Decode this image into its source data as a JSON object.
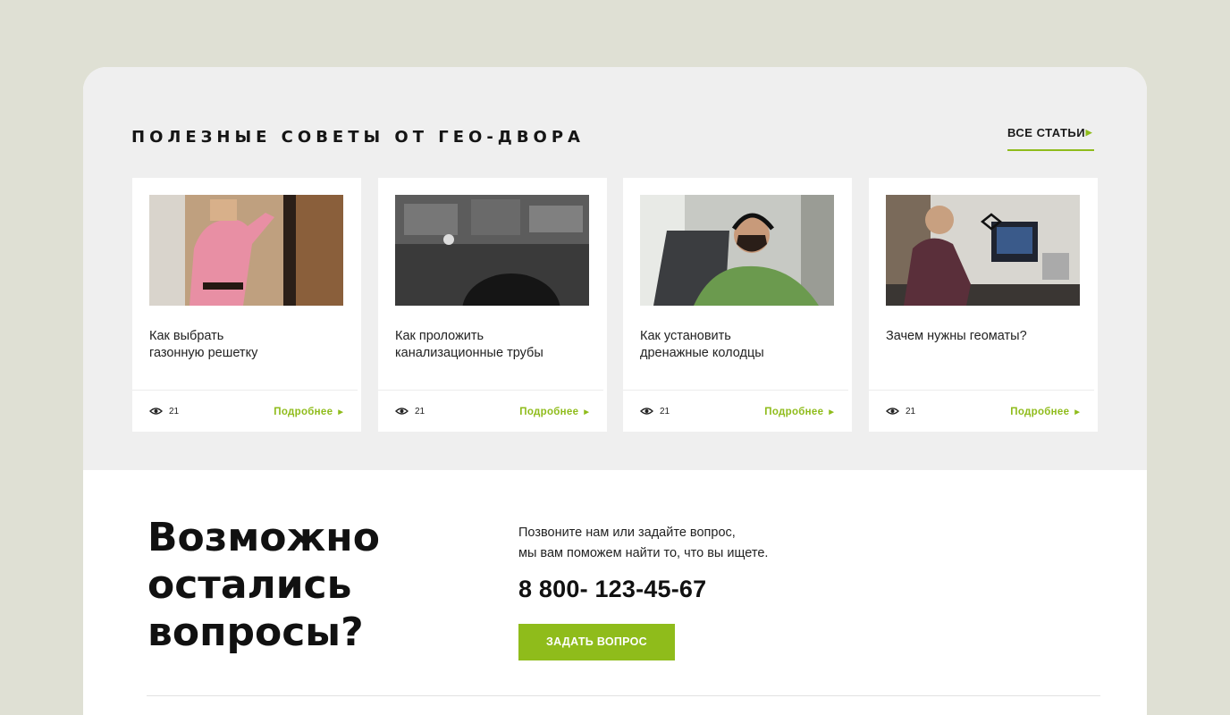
{
  "tips": {
    "title": "ПОЛЕЗНЫЕ СОВЕТЫ ОТ ГЕО-ДВОРА",
    "all_articles": "ВСЕ СТАТЬИ",
    "cards": [
      {
        "line1": "Как выбрать",
        "line2": "газонную решетку",
        "views": "21",
        "more": "Подробнее",
        "image": "woman-in-pink-shirt-photo"
      },
      {
        "line1": "Как проложить",
        "line2": "канализационные трубы",
        "views": "21",
        "more": "Подробнее",
        "image": "grayscale-monitors-photo"
      },
      {
        "line1": "Как установить",
        "line2": "дренажные колодцы",
        "views": "21",
        "more": "Подробнее",
        "image": "man-with-headphones-photo"
      },
      {
        "line1": "Зачем нужны геоматы?",
        "line2": "",
        "views": "21",
        "more": "Подробнее",
        "image": "man-at-desk-photo"
      }
    ]
  },
  "questions": {
    "title_lines": [
      "Возможно",
      "остались",
      "вопросы?"
    ],
    "text_line1": "Позвоните нам или задайте вопрос,",
    "text_line2": "мы вам поможем найти то, что вы ищете.",
    "phone": "8 800- 123-45-67",
    "button": "ЗАДАТЬ ВОПРОС"
  },
  "colors": {
    "accent": "#8fbc1b",
    "page_bg": "#dfe0d4",
    "section_bg": "#efefef"
  },
  "icons": {
    "views": "eye-icon",
    "arrow": "chevron-right-icon"
  }
}
